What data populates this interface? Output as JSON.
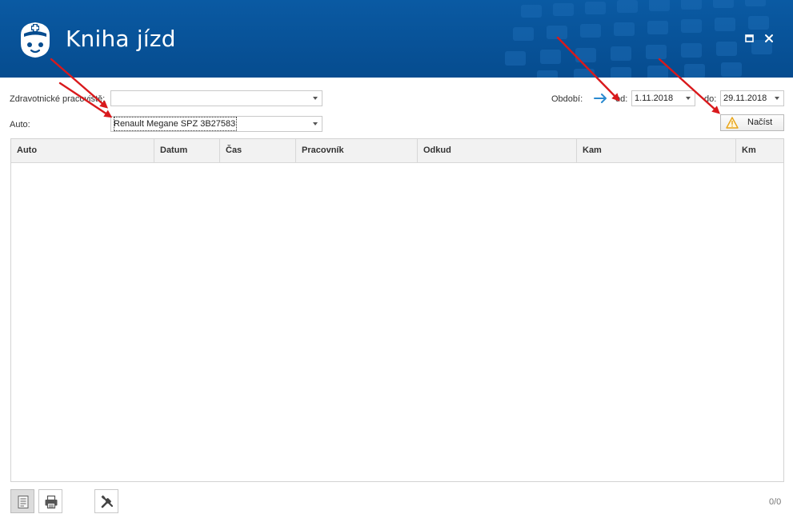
{
  "window": {
    "title": "Kniha jízd",
    "icon": "nurse-icon",
    "controls": [
      "maximize-icon",
      "close-icon"
    ]
  },
  "filters": {
    "workplace_label": "Zdravotnické pracoviště:",
    "workplace_value": "",
    "car_label": "Auto:",
    "car_value": "Renault Megane SPZ 3B27583",
    "period_label": "Období:",
    "from_label": "od:",
    "from_value": "1.11.2018",
    "to_label": "do:",
    "to_value": "29.11.2018",
    "load_button": "Načíst"
  },
  "table": {
    "columns": [
      "Auto",
      "Datum",
      "Čas",
      "Pracovník",
      "Odkud",
      "Kam",
      "Km"
    ],
    "rows": []
  },
  "footer": {
    "tools": [
      "list-view-icon",
      "print-icon",
      "tools-icon"
    ],
    "counter": "0/0"
  },
  "colors": {
    "titlebar": "#064c8f",
    "annotation_arrow": "#d9191c",
    "accent_arrow": "#2a8ad0",
    "warning": "#e8a317"
  }
}
